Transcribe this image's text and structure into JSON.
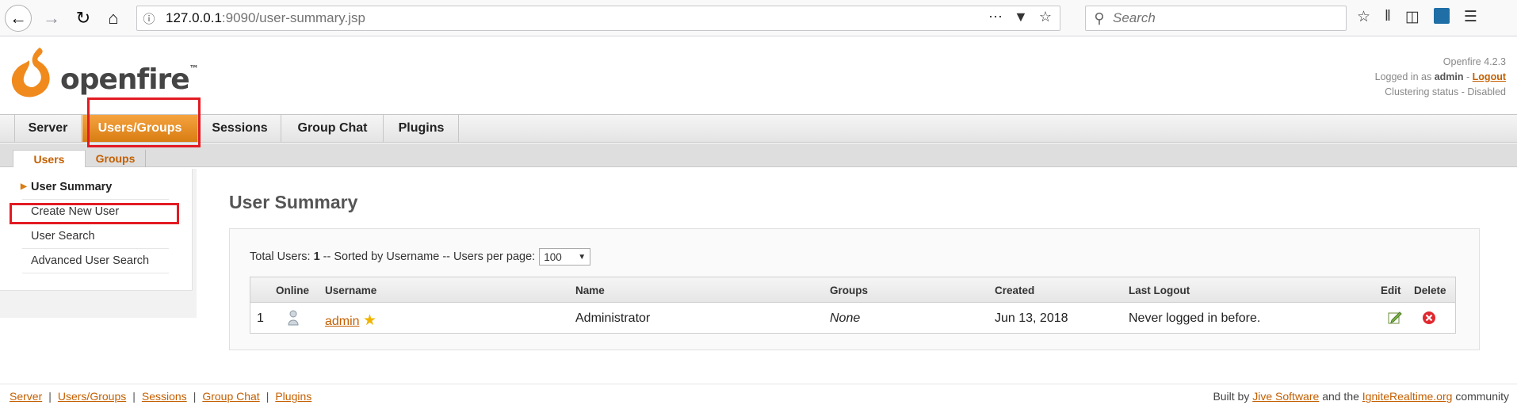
{
  "browser": {
    "url_host": "127.0.0.1",
    "url_path": ":9090/user-summary.jsp",
    "search_placeholder": "Search"
  },
  "header": {
    "logo_text": "openfire",
    "logo_tm": "™",
    "version": "Openfire 4.2.3",
    "logged_in_prefix": "Logged in as",
    "user": "admin",
    "separator": "-",
    "logout_label": "Logout",
    "clustering": "Clustering status - Disabled"
  },
  "main_tabs": [
    {
      "label": "Server",
      "active": false
    },
    {
      "label": "Users/Groups",
      "active": true
    },
    {
      "label": "Sessions",
      "active": false
    },
    {
      "label": "Group Chat",
      "active": false
    },
    {
      "label": "Plugins",
      "active": false
    }
  ],
  "sub_tabs": [
    {
      "label": "Users",
      "active": true
    },
    {
      "label": "Groups",
      "active": false
    }
  ],
  "sidebar": {
    "items": [
      {
        "label": "User Summary",
        "active": true
      },
      {
        "label": "Create New User",
        "active": false
      },
      {
        "label": "User Search",
        "active": false
      },
      {
        "label": "Advanced User Search",
        "active": false
      }
    ]
  },
  "main": {
    "title": "User Summary",
    "summary_prefix": "Total Users:",
    "total_users": "1",
    "summary_suffix": "-- Sorted by Username -- Users per page:",
    "per_page": "100",
    "columns": [
      "Online",
      "Username",
      "Name",
      "Groups",
      "Created",
      "Last Logout",
      "Edit",
      "Delete"
    ],
    "rows": [
      {
        "index": "1",
        "username": "admin",
        "name": "Administrator",
        "groups": "None",
        "created": "Jun 13, 2018",
        "last_logout": "Never logged in before."
      }
    ]
  },
  "footer": {
    "links": [
      "Server",
      "Users/Groups",
      "Sessions",
      "Group Chat",
      "Plugins"
    ],
    "built_by": "Built by",
    "jive": "Jive Software",
    "and_the": "and the",
    "ignite": "IgniteRealtime.org",
    "community": "community"
  },
  "colors": {
    "accent": "#d87d12",
    "link": "#c45f00",
    "highlight": "#e21b23"
  }
}
